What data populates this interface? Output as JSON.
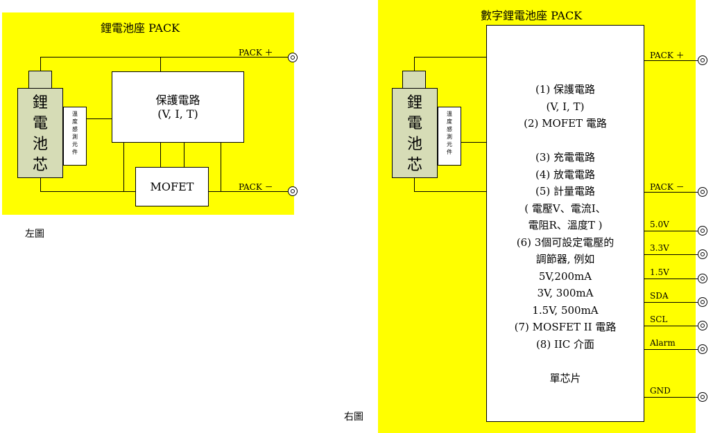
{
  "left": {
    "title": "鋰電池座 PACK",
    "cell_chars": [
      "鋰",
      "電",
      "池",
      "芯"
    ],
    "sensor_chars": [
      "溫",
      "度",
      "感",
      "測",
      "元",
      "件"
    ],
    "protect_line1": "保護電路",
    "protect_line2": "(V, I, T)",
    "mofet_label": "MOFET",
    "pack_plus": "PACK ＋",
    "pack_minus": "PACK －",
    "caption": "左圖"
  },
  "right": {
    "title": "數字鋰電池座 PACK",
    "cell_chars": [
      "鋰",
      "電",
      "池",
      "芯"
    ],
    "sensor_chars": [
      "溫",
      "度",
      "感",
      "測",
      "元",
      "件"
    ],
    "chip_lines": [
      "(1) 保護電路",
      "(V, I, T)",
      "(2) MOFET 電路",
      "",
      "(3) 充電電路",
      "(4) 放電電路",
      "(5) 計量電路",
      "( 電壓V、電流I、",
      "電阻R、溫度T )",
      "(6) 3個可設定電壓的",
      "調節器, 例如",
      "5V,200mA",
      "3V, 300mA",
      "1.5V, 500mA",
      "(7) MOSFET II 電路",
      "(8) IIC 介面",
      "",
      "單芯片"
    ],
    "pins": [
      "PACK ＋",
      "PACK －",
      "5.0V",
      "3.3V",
      "1.5V",
      "SDA",
      "SCL",
      "Alarm",
      "GND"
    ],
    "caption": "右圖"
  }
}
